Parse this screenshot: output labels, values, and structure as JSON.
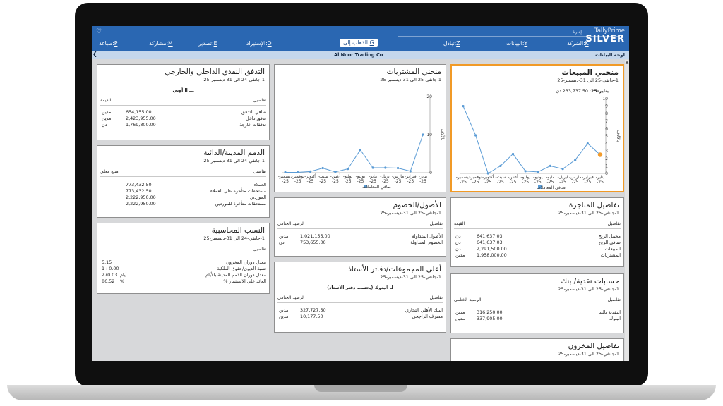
{
  "app": {
    "brand": "TallyPrime",
    "edition": "SILVER",
    "admin": "إدارة"
  },
  "menu": [
    {
      "key": "K",
      "label": "الشركة",
      "active": false
    },
    {
      "key": "Y",
      "label": "البيانات",
      "active": false
    },
    {
      "key": "Z",
      "label": "تبادل",
      "active": false
    },
    {
      "key": "G",
      "label": "الذهاب إلى",
      "active": true
    },
    {
      "key": "O",
      "label": "الإستيراد",
      "active": false
    },
    {
      "key": "E",
      "label": "تصدير",
      "active": false
    },
    {
      "key": "M",
      "label": "مشاركة",
      "active": false
    },
    {
      "key": "P",
      "label": "طباعة",
      "active": false
    }
  ],
  "subbar": {
    "company": "Al Noor Trading Co",
    "dashboard": "لوحة البيانات"
  },
  "sales_tile": {
    "title": "منحني المبيعات",
    "period": "1-جانفي-25 الى 31-ديسمبر-25",
    "tooltip_label": "يناير-25",
    "tooltip_value": "233,737.50 دن",
    "y_axis_label": "بالآلاف",
    "legend": "صافي المعاملات"
  },
  "purchase_tile": {
    "title": "منحني المشتريات",
    "period": "1-جانفي-25 الى 31-ديسمبر-25",
    "y_axis_label": "بالآلاف",
    "legend": "صافي المعاملات"
  },
  "cashflow_tile": {
    "title": "التدفق النقدي الداخلي والخارجي",
    "period": "1-جانفي-24 الى 31-ديسمبر-25",
    "group_label": "ـــ ll أوتي",
    "col_particulars": "تفاصيل",
    "col_value": "القيمة",
    "rows": [
      {
        "label": "صافي التدفق",
        "value": "654,155.00",
        "unit": "مدين"
      },
      {
        "label": "تدفق داخل",
        "value": "2,423,955.00",
        "unit": "مدين"
      },
      {
        "label": "تدفقات خارجة",
        "value": "1,769,800.00",
        "unit": "دن"
      }
    ]
  },
  "receivables_tile": {
    "title": "الذمم المدينة/الدائنة",
    "period": "1-جانفي-24 الى 31-ديسمبر-25",
    "col_particulars": "تفاصيل",
    "col_value": "مبلغ معلق",
    "rows": [
      {
        "label": "العملاء",
        "value": "773,432.50"
      },
      {
        "label": "مستحقات متأخرة على العملاء",
        "value": "773,432.50"
      },
      {
        "label": "الموردين",
        "value": "2,222,950.00"
      },
      {
        "label": "مستحقات متأخرة للموردين",
        "value": "2,222,950.00"
      }
    ]
  },
  "ratios_tile": {
    "title": "النسب المحاسبية",
    "period": "1-جانفي-24 الى 31-ديسمبر-25",
    "col_particulars": "تفاصيل",
    "rows": [
      {
        "label": "معدل دوران المخزون",
        "value": "5.15",
        "unit": ""
      },
      {
        "label": "نسبة الديون/حقوق الملكية",
        "value": "1 : 0.00",
        "unit": ""
      },
      {
        "label": "معدل دوران الذمم المدينة بالأيام",
        "value": "270.03",
        "unit": "أيام"
      },
      {
        "label": "العائد على الاستثمار %",
        "value": "86.52",
        "unit": "%"
      }
    ]
  },
  "assets_tile": {
    "title": "الأصول/الخصوم",
    "period": "1-جانفي-25 الى 31-ديسمبر-25",
    "col_particulars": "تفاصيل",
    "col_value": "الرصيد الختامي",
    "rows": [
      {
        "label": "الأصول المتداولة",
        "value": "1,021,155.00",
        "unit": "مدين"
      },
      {
        "label": "الخصوم المتداولة",
        "value": "753,655.00",
        "unit": "دن"
      }
    ]
  },
  "groups_tile": {
    "title": "أعلي المجموعات/دفاتر الأستاذ",
    "period": "1-جانفي-25 الى 31-ديسمبر-25",
    "group_label": "لـ البنوك (بحسب دفتر الأستاذ)",
    "col_particulars": "تفاصيل",
    "col_value": "الرصيد الختامي",
    "rows": [
      {
        "label": "البنك الأهلي التجاري",
        "value": "327,727.50",
        "unit": "مدين"
      },
      {
        "label": "مصرف الراجحي",
        "value": "10,177.50",
        "unit": "مدين"
      }
    ]
  },
  "trading_tile": {
    "title": "تفاصيل المتاجرة",
    "period": "1-جانفي-25 الى 31-ديسمبر-25",
    "col_particulars": "تفاصيل",
    "col_value": "القيمة",
    "rows": [
      {
        "label": "مجمل الربح",
        "value": "641,637.03",
        "unit": "دن"
      },
      {
        "label": "صافي الربح",
        "value": "641,637.03",
        "unit": "دن"
      },
      {
        "label": "المبيعات",
        "value": "2,291,500.00",
        "unit": "دن"
      },
      {
        "label": "المشتريات",
        "value": "1,958,000.00",
        "unit": "مدين"
      }
    ]
  },
  "bank_tile": {
    "title": "حسابات نقدية/ بنك",
    "period": "1-جانفي-25 الى 31-ديسمبر-25",
    "col_particulars": "تفاصيل",
    "col_value": "الرصيد الختامي",
    "rows": [
      {
        "label": "النقدية باليد",
        "value": "316,250.00",
        "unit": "مدين"
      },
      {
        "label": "البنوك",
        "value": "337,905.00",
        "unit": "مدين"
      }
    ]
  },
  "stock_tile": {
    "title": "تفاصيل المخزون",
    "period": "1-جانفي-25 الى 31-ديسمبر-25"
  },
  "chart_data": [
    {
      "type": "line",
      "title": "منحني المبيعات",
      "ylabel": "بالآلاف",
      "ylim": [
        0,
        10
      ],
      "yticks": [
        0,
        1,
        2,
        3,
        4,
        5,
        6,
        7,
        8,
        9,
        10
      ],
      "categories": [
        "يناير-25",
        "فبراير-25",
        "مارس-25",
        "ابريل-25",
        "مايو-25",
        "يونيو-25",
        "يوليو-25",
        "أغس-25",
        "سبت-25",
        "أكتوبر-25",
        "نوفمبر-25",
        "ديسمبر-25"
      ],
      "series": [
        {
          "name": "صافي المعاملات",
          "values": [
            2.5,
            4.0,
            1.8,
            0.6,
            1.0,
            0.2,
            0.3,
            2.6,
            1.0,
            0.0,
            5.1,
            9.0
          ]
        }
      ],
      "highlight_index": 0,
      "line_color": "#5a9bd5",
      "highlight_color": "#f39c2c"
    },
    {
      "type": "line",
      "title": "منحني المشتريات",
      "ylabel": "بالآلاف",
      "ylim": [
        0,
        20
      ],
      "yticks": [
        0,
        10,
        20
      ],
      "categories": [
        "يناير-25",
        "فبراير-25",
        "مارس-25",
        "ابريل-25",
        "مايو-25",
        "يونيو-25",
        "يوليو-25",
        "أغس-25",
        "سبت-25",
        "أكتوبر-25",
        "نوفمبر-25",
        "ديسمبر-25"
      ],
      "series": [
        {
          "name": "صافي المعاملات",
          "values": [
            10.0,
            0.4,
            1.2,
            1.3,
            1.3,
            6.0,
            1.0,
            0.2,
            1.2,
            0.3,
            0.1,
            0.1
          ]
        }
      ],
      "line_color": "#5a9bd5"
    }
  ]
}
